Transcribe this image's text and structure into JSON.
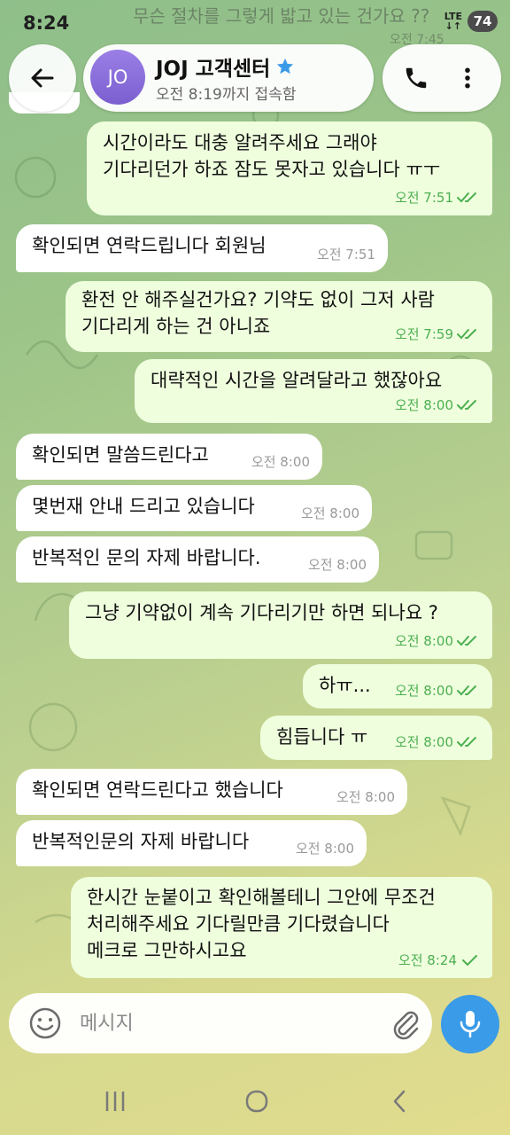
{
  "status_bar": {
    "time": "8:24",
    "network": "LTE",
    "battery": "74"
  },
  "previous_message_peek": {
    "text": "무슨 절차를 그렇게 밟고 있는 건가요 ??",
    "time": "오전 7:45"
  },
  "header": {
    "avatar_initials": "JO",
    "chat_name": "JOJ 고객센터",
    "status": "오전 8:19까지 접속함"
  },
  "messages": [
    {
      "dir": "out",
      "lines": [
        "시간이라도 대충 알려주세요 그래야",
        "기다리던가 하죠 잠도 못자고 있습니다 ㅠㅜ"
      ],
      "time": "오전 7:51",
      "read": true
    },
    {
      "dir": "in",
      "lines": [
        "확인되면 연락드립니다 회원님"
      ],
      "time": "오전 7:51"
    },
    {
      "dir": "out",
      "lines": [
        "환전 안 해주실건가요? 기약도 없이 그저 사람",
        "기다리게 하는 건 아니죠"
      ],
      "time": "오전 7:59",
      "read": true
    },
    {
      "dir": "out",
      "lines": [
        "대략적인 시간을 알려달라고 했잖아요"
      ],
      "time": "오전 8:00",
      "read": true
    },
    {
      "dir": "in",
      "lines": [
        "확인되면 말씀드린다고"
      ],
      "time": "오전 8:00"
    },
    {
      "dir": "in",
      "lines": [
        "몇번재 안내 드리고 있습니다"
      ],
      "time": "오전 8:00"
    },
    {
      "dir": "in",
      "lines": [
        "반복적인 문의 자제 바랍니다."
      ],
      "time": "오전 8:00"
    },
    {
      "dir": "out",
      "lines": [
        "그냥 기약없이 계속 기다리기만 하면 되나요 ?"
      ],
      "time": "오전 8:00",
      "read": true
    },
    {
      "dir": "out",
      "lines": [
        "하ㅠ..."
      ],
      "time": "오전 8:00",
      "read": true
    },
    {
      "dir": "out",
      "lines": [
        "힘듭니다 ㅠ"
      ],
      "time": "오전 8:00",
      "read": true
    },
    {
      "dir": "in",
      "lines": [
        "확인되면 연락드린다고 했습니다"
      ],
      "time": "오전 8:00"
    },
    {
      "dir": "in",
      "lines": [
        "반복적인문의 자제 바랍니다"
      ],
      "time": "오전 8:00"
    },
    {
      "dir": "out",
      "lines": [
        "한시간 눈붙이고 확인해볼테니 그안에 무조건",
        "처리해주세요 기다릴만큼 기다렸습니다",
        "메크로 그만하시고요"
      ],
      "time": "오전 8:24",
      "read": false
    }
  ],
  "composer": {
    "placeholder": "메시지"
  },
  "colors": {
    "accent": "#3a9be8",
    "outgoing_bubble": "#efffde",
    "incoming_bubble": "#ffffff",
    "check": "#4caf50",
    "avatar": "#8b6fdc"
  },
  "icons": {
    "back": "arrow-left-icon",
    "verified": "star-icon",
    "call": "phone-icon",
    "menu": "more-vertical-icon",
    "emoji": "smile-icon",
    "attach": "paperclip-icon",
    "mic": "microphone-icon",
    "nav_recent": "recent-apps-icon",
    "nav_home": "home-icon",
    "nav_back": "nav-back-icon",
    "read": "double-check-icon",
    "sent": "single-check-icon"
  }
}
